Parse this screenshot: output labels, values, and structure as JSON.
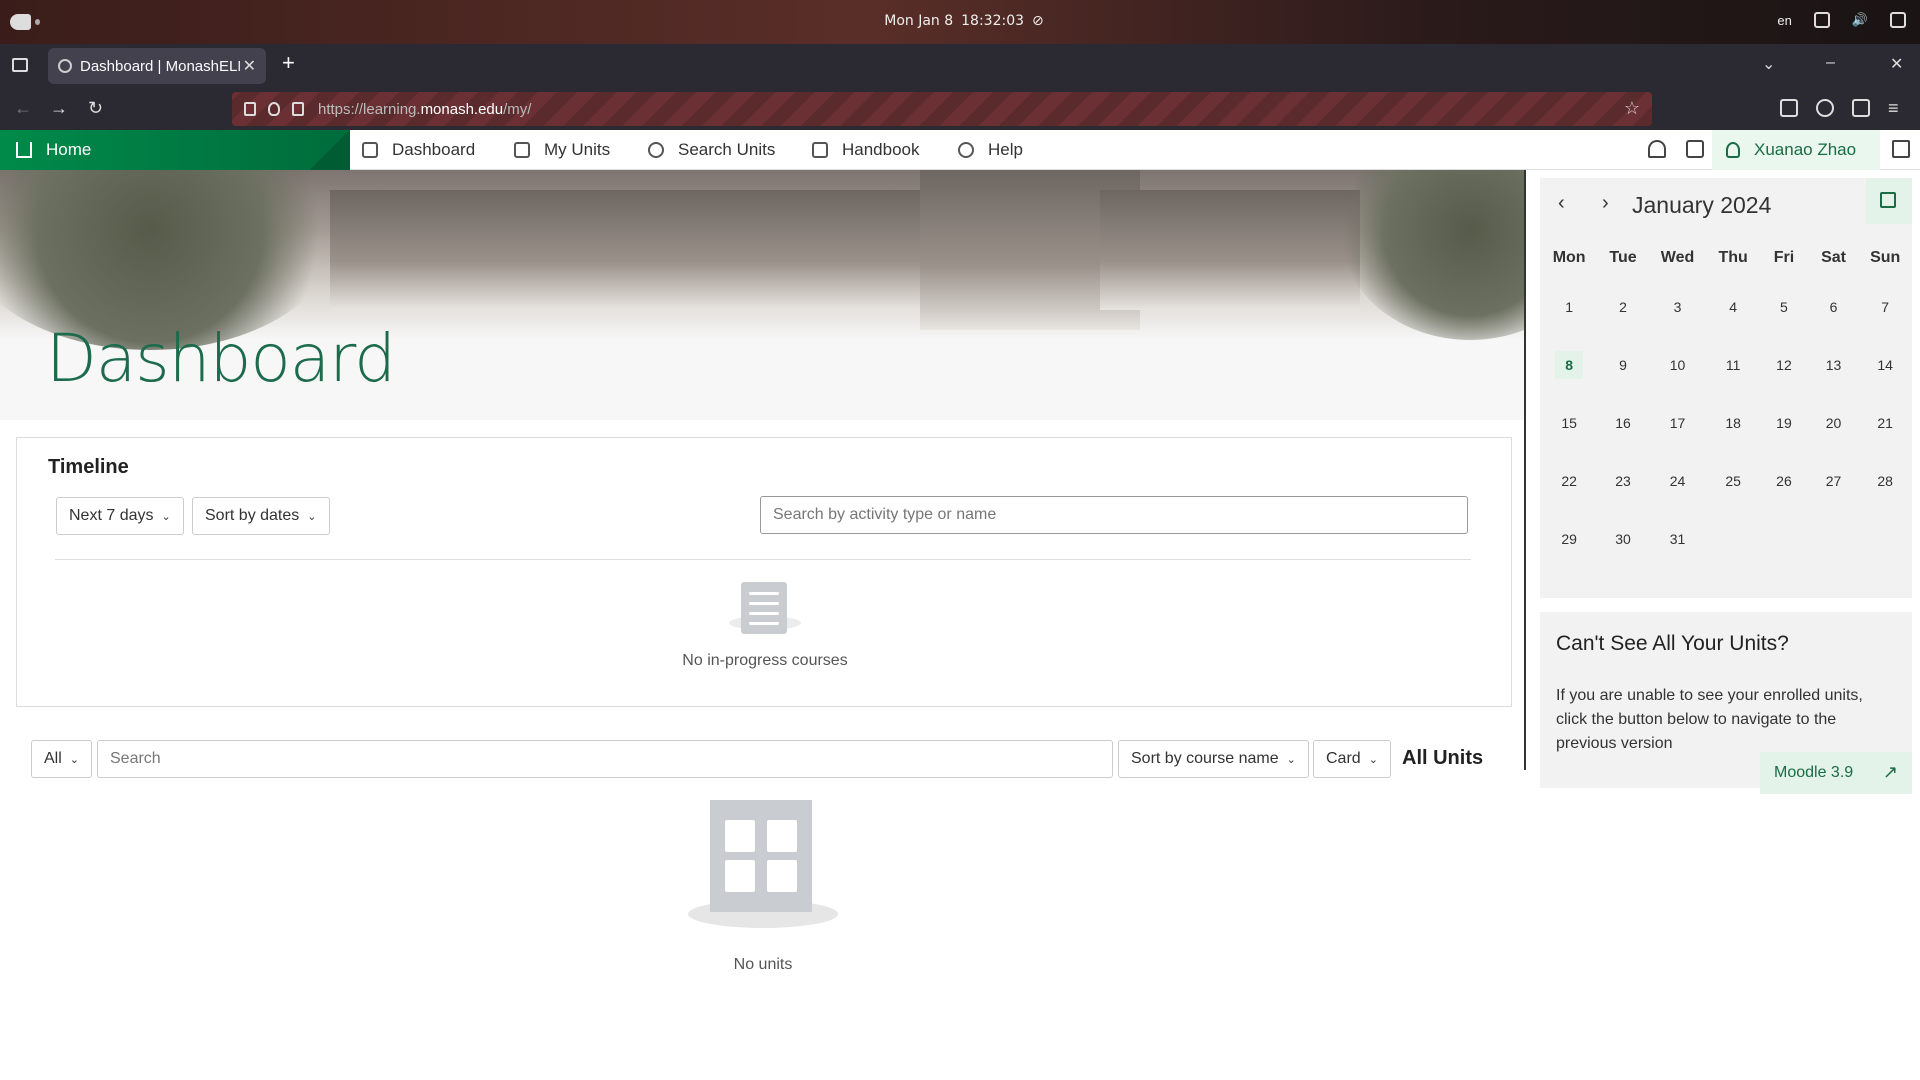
{
  "os": {
    "date": "Mon Jan 8",
    "time": "18:32:03",
    "lang": "en"
  },
  "browser": {
    "tab_title": "Dashboard | MonashELMS",
    "url_prefix": "https://learning.",
    "url_host": "monash.edu",
    "url_path": "/my/"
  },
  "nav": {
    "home": "Home",
    "dashboard": "Dashboard",
    "my_units": "My Units",
    "search_units": "Search Units",
    "handbook": "Handbook",
    "help": "Help",
    "user": "Xuanao Zhao"
  },
  "page": {
    "title": "Dashboard"
  },
  "timeline": {
    "heading": "Timeline",
    "range": "Next 7 days",
    "sort": "Sort by dates",
    "search_placeholder": "Search by activity type or name",
    "empty": "No in-progress courses"
  },
  "units": {
    "filter": "All",
    "search_placeholder": "Search",
    "sort": "Sort by course name",
    "view": "Card",
    "heading": "All Units",
    "empty": "No units"
  },
  "calendar": {
    "month": "January 2024",
    "weekdays": [
      "Mon",
      "Tue",
      "Wed",
      "Thu",
      "Fri",
      "Sat",
      "Sun"
    ],
    "weeks": [
      [
        "1",
        "2",
        "3",
        "4",
        "5",
        "6",
        "7"
      ],
      [
        "8",
        "9",
        "10",
        "11",
        "12",
        "13",
        "14"
      ],
      [
        "15",
        "16",
        "17",
        "18",
        "19",
        "20",
        "21"
      ],
      [
        "22",
        "23",
        "24",
        "25",
        "26",
        "27",
        "28"
      ],
      [
        "29",
        "30",
        "31",
        "",
        "",
        "",
        ""
      ]
    ],
    "today": "8"
  },
  "notice": {
    "heading": "Can't See All Your Units?",
    "body": "If you are unable to see your enrolled units, click the button below to navigate to the previous version",
    "button": "Moodle 3.9"
  },
  "colors": {
    "brand_green": "#1d6b4d",
    "home_band": "#008a4a",
    "highlight": "#e3f3ea"
  }
}
